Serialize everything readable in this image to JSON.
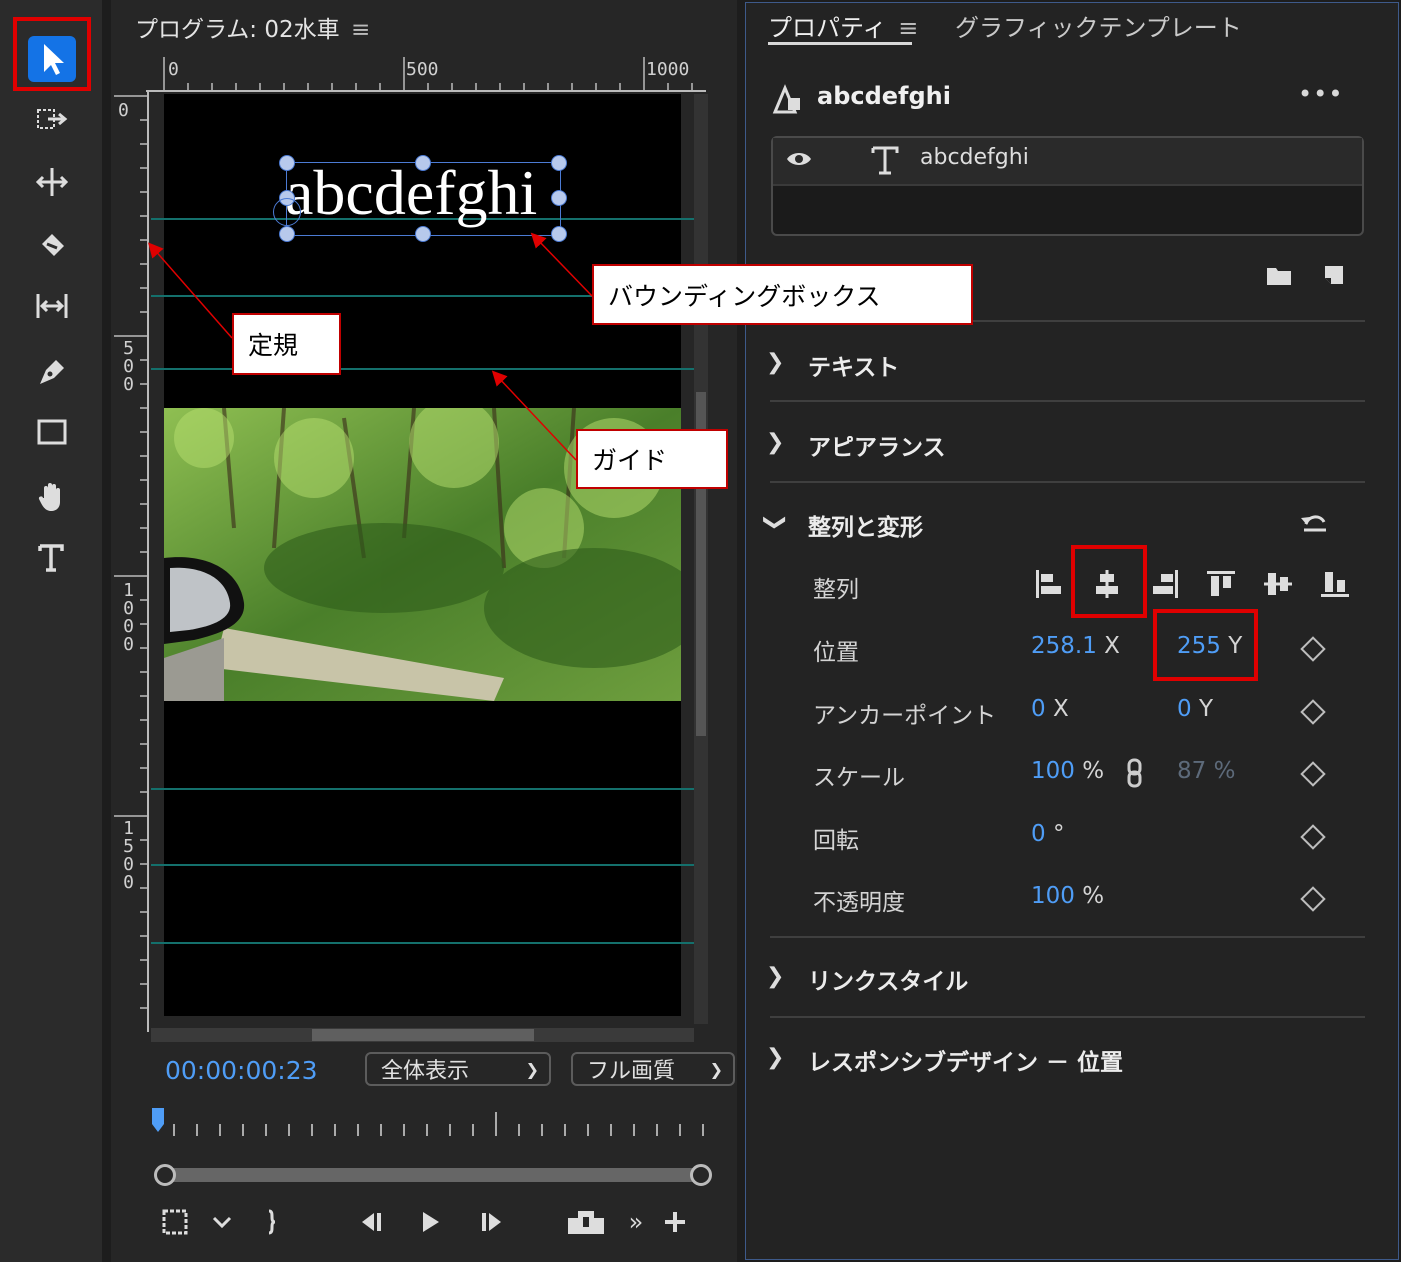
{
  "program": {
    "title": "プログラム: 02水車",
    "menu_icon": "hamburger-icon",
    "ruler_top": [
      "0",
      "500",
      "1000"
    ],
    "ruler_left": [
      "0",
      "500",
      "1000",
      "1500"
    ],
    "sample_text": "abcdefghi",
    "timecode": "00:00:00:23",
    "zoom_select": "全体表示",
    "quality_select": "フル画質"
  },
  "properties": {
    "tab_properties": "プロパティ",
    "tab_graphics_template": "グラフィックテンプレート",
    "layer_name": "abcdefghi",
    "more": "•••",
    "layer_row_text": "abcdefghi",
    "sections": {
      "text": "テキスト",
      "appearance": "アピアランス",
      "align_transform": "整列と変形",
      "link_style": "リンクスタイル",
      "responsive": "レスポンシブデザイン － 位置"
    },
    "align_label": "整列",
    "position": {
      "label": "位置",
      "x": "258.1",
      "x_axis": "X",
      "y": "255",
      "y_axis": "Y"
    },
    "anchor": {
      "label": "アンカーポイント",
      "x": "0",
      "x_axis": "X",
      "y": "0",
      "y_axis": "Y"
    },
    "scale": {
      "label": "スケール",
      "value": "100",
      "unit": "%",
      "width_value": "87",
      "width_unit": "%"
    },
    "rotation": {
      "label": "回転",
      "value": "0",
      "unit": "°"
    },
    "opacity": {
      "label": "不透明度",
      "value": "100",
      "unit": "%"
    }
  },
  "annotations": {
    "ruler": "定規",
    "bounding_box": "バウンディングボックス",
    "guide": "ガイド"
  },
  "colors": {
    "accent": "#1473e6",
    "value_blue": "#4f9df6",
    "annotation_red": "#e00000",
    "guide_teal": "#14706c"
  }
}
